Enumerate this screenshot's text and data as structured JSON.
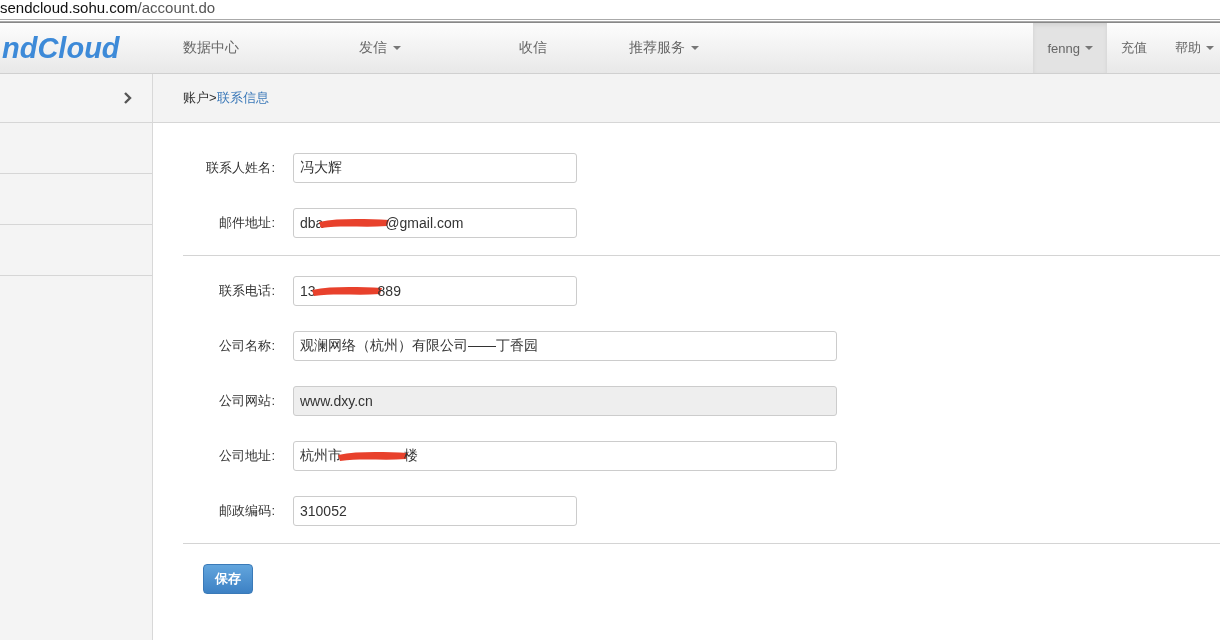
{
  "address_bar": {
    "host": "sendcloud.sohu.com",
    "path": "/account.do"
  },
  "navbar": {
    "logo": "ndCloud",
    "items": [
      {
        "label": "数据中心",
        "dropdown": false,
        "selected": false
      },
      {
        "label": "发信",
        "dropdown": true,
        "selected": false
      },
      {
        "label": "收信",
        "dropdown": false,
        "selected": false
      },
      {
        "label": "推荐服务",
        "dropdown": true,
        "selected": false
      }
    ],
    "right_items": [
      {
        "label": "fenng",
        "dropdown": true,
        "selected": true
      },
      {
        "label": "充值",
        "dropdown": false,
        "selected": false
      },
      {
        "label": "帮助",
        "dropdown": true,
        "selected": false
      }
    ]
  },
  "sidebar": {
    "items": [
      {
        "kind": "toggle"
      },
      {
        "kind": "blank"
      },
      {
        "kind": "blank"
      },
      {
        "kind": "blank"
      }
    ]
  },
  "breadcrumb": {
    "parent": "账户>",
    "current": "联系信息"
  },
  "form": {
    "sections": [
      {
        "fields": [
          {
            "label": "联系人姓名:",
            "value_parts": [
              "冯大辉"
            ],
            "wide": false,
            "disabled": false
          },
          {
            "label": "邮件地址:",
            "value_parts": [
              "dba",
              "@gmail.com"
            ],
            "wide": false,
            "disabled": false
          }
        ]
      },
      {
        "fields": [
          {
            "label": "联系电话:",
            "value_parts": [
              "13",
              "889"
            ],
            "wide": false,
            "disabled": false
          },
          {
            "label": "公司名称:",
            "value_parts": [
              "观澜网络（杭州）有限公司——丁香园"
            ],
            "wide": true,
            "disabled": false
          },
          {
            "label": "公司网站:",
            "value_parts": [
              "www.dxy.cn"
            ],
            "wide": true,
            "disabled": true
          },
          {
            "label": "公司地址:",
            "value_parts": [
              "杭州市",
              "楼"
            ],
            "wide": true,
            "disabled": false
          },
          {
            "label": "邮政编码:",
            "value_parts": [
              "310052"
            ],
            "wide": false,
            "disabled": false
          }
        ]
      }
    ],
    "save_button": "保存"
  }
}
